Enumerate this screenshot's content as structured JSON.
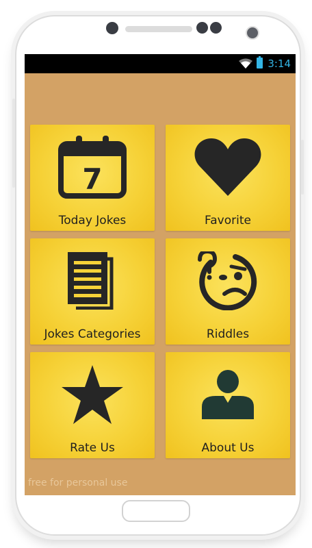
{
  "status_bar": {
    "time": "3:14",
    "icons": [
      "wifi-icon",
      "battery-icon"
    ],
    "accent_color": "#33b5e5"
  },
  "screen": {
    "background_color": "#d3a265",
    "tile_color": "#f6d238",
    "icon_color": "#262626"
  },
  "menu": {
    "items": [
      {
        "label": "Today Jokes",
        "icon": "calendar-icon"
      },
      {
        "label": "Favorite",
        "icon": "heart-icon"
      },
      {
        "label": "Jokes Categories",
        "icon": "documents-icon"
      },
      {
        "label": "Riddles",
        "icon": "confused-face-icon"
      },
      {
        "label": "Rate Us",
        "icon": "star-icon"
      },
      {
        "label": "About Us",
        "icon": "user-icon"
      }
    ]
  },
  "calendar_day": "7",
  "watermark": "free for personal use"
}
